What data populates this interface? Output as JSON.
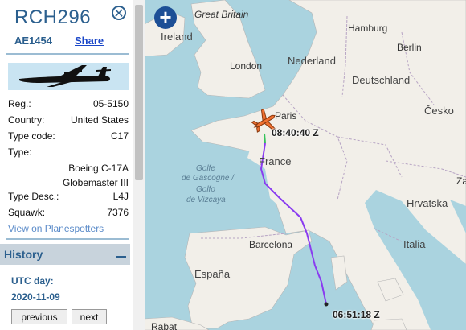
{
  "aircraft": {
    "callsign": "RCH296",
    "icao": "AE1454",
    "share_label": "Share",
    "fields": [
      {
        "label": "Reg.:",
        "value": "05-5150"
      },
      {
        "label": "Country:",
        "value": "United States"
      },
      {
        "label": "Type code:",
        "value": "C17"
      },
      {
        "label": "Type:",
        "value": "Boeing C-17A Globemaster III"
      },
      {
        "label": "Type Desc.:",
        "value": "L4J"
      },
      {
        "label": "Squawk:",
        "value": "7376"
      }
    ],
    "spotters_link": "View on Planespotters"
  },
  "history": {
    "title": "History",
    "utc_label": "UTC day:",
    "utc_date": "2020-11-09",
    "prev_label": "previous",
    "next_label": "next"
  },
  "map": {
    "labels": {
      "great_britain": "Great Britain",
      "ireland": "Ireland",
      "london": "London",
      "hamburg": "Hamburg",
      "nederland": "Nederland",
      "berlin": "Berlin",
      "deutschland": "Deutschland",
      "cesko": "Česko",
      "paris": "Paris",
      "france": "France",
      "golfe1": "Golfe",
      "golfe2": "de Gascogne /",
      "golfe3": "Golfo",
      "golfe4": "de Vizcaya",
      "hrvatska": "Hrvatska",
      "barcelona": "Barcelona",
      "italia": "Italia",
      "espana": "España",
      "rabat": "Rabat",
      "zag": "Zag"
    },
    "timestamps": {
      "current": "08:40:40 Z",
      "start": "06:51:18 Z"
    },
    "colors": {
      "water": "#aad3df",
      "land": "#f2efe9",
      "track_purple": "#8a3cf0",
      "track_green": "#35c25a",
      "plane": "#f07030"
    }
  }
}
